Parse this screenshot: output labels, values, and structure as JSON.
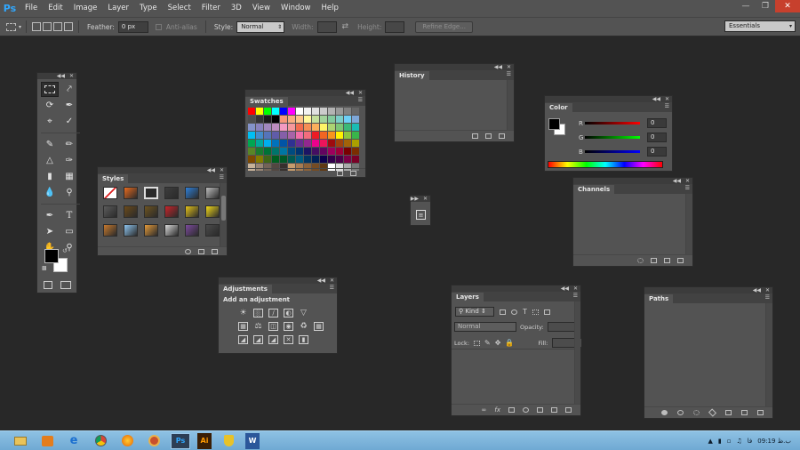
{
  "menubar": {
    "app_logo": "Ps",
    "items": [
      "File",
      "Edit",
      "Image",
      "Layer",
      "Type",
      "Select",
      "Filter",
      "3D",
      "View",
      "Window",
      "Help"
    ]
  },
  "options": {
    "feather_label": "Feather:",
    "feather_value": "0 px",
    "antialias_label": "Anti-alias",
    "style_label": "Style:",
    "style_value": "Normal",
    "width_label": "Width:",
    "height_label": "Height:",
    "refine_edge_label": "Refine Edge...",
    "workspace": "Essentials"
  },
  "panels": {
    "swatches": "Swatches",
    "styles": "Styles",
    "history": "History",
    "color": "Color",
    "channels": "Channels",
    "adjustments": "Adjustments",
    "adjustments_heading": "Add an adjustment",
    "layers": "Layers",
    "paths": "Paths"
  },
  "color_panel": {
    "r_label": "R",
    "r_value": "0",
    "g_label": "G",
    "g_value": "0",
    "b_label": "B",
    "b_value": "0"
  },
  "layers_panel": {
    "kind_label": "Kind",
    "blend_mode": "Normal",
    "opacity_label": "Opacity:",
    "lock_label": "Lock:",
    "fill_label": "Fill:"
  },
  "swatch_colors": [
    "#ff0000",
    "#ffff00",
    "#00ff00",
    "#00ffff",
    "#0000ff",
    "#ff00ff",
    "#ffffff",
    "#f2f2f2",
    "#e0e0e0",
    "#cccccc",
    "#b3b3b3",
    "#999999",
    "#808080",
    "#666666",
    "#4d4d4d",
    "#333333",
    "#1a1a1a",
    "#000000",
    "#f7977a",
    "#f9ad81",
    "#fdc68a",
    "#fff79a",
    "#c4df9b",
    "#a2d39c",
    "#82ca9d",
    "#7bcdc8",
    "#6ecff6",
    "#7ea7d8",
    "#8493ca",
    "#8882be",
    "#a187be",
    "#bc8dbf",
    "#f49ac2",
    "#f6989d",
    "#f26c4f",
    "#f68e55",
    "#fbaf5c",
    "#fff467",
    "#acd372",
    "#7cc576",
    "#3bb878",
    "#1abbb4",
    "#00bff3",
    "#438ccb",
    "#5574b9",
    "#605ca8",
    "#855fa8",
    "#a763a8",
    "#f06ea9",
    "#f26d7d",
    "#ed1c24",
    "#f26522",
    "#f7941d",
    "#fff200",
    "#8dc63f",
    "#39b54a",
    "#00a651",
    "#00a99d",
    "#00aeef",
    "#0072bc",
    "#0054a6",
    "#2e3192",
    "#662d91",
    "#92278f",
    "#ec008c",
    "#ed145b",
    "#9e0b0f",
    "#a0410d",
    "#a36209",
    "#aba000",
    "#598527",
    "#1a7b30",
    "#007236",
    "#00746b",
    "#0076a3",
    "#004b80",
    "#003471",
    "#1b1464",
    "#440e62",
    "#630460",
    "#9e005d",
    "#9e0039",
    "#790000",
    "#7b2e00",
    "#7d4900",
    "#827b00",
    "#406618",
    "#005e20",
    "#005826",
    "#005952",
    "#005b7f",
    "#003663",
    "#002157",
    "#0d004c",
    "#32004b",
    "#4b0049",
    "#7b0046",
    "#7a0026",
    "#c7b299",
    "#998675",
    "#736357",
    "#534741",
    "#37302d",
    "#c69c6d",
    "#a67c52",
    "#8c6239",
    "#754c24",
    "#603913",
    "#ffffff",
    "#dddddd",
    "#aaaaaa",
    "#777777"
  ],
  "style_colors": [
    "#f4f4f4",
    "#e86a1e",
    "#2a2a2a",
    "#3d3d3d",
    "#2f7fd8",
    "#bdbdbd",
    "#5c5c5c",
    "#6b4a1a",
    "#6e5420",
    "#c8242a",
    "#e3c21a",
    "#f2d91a",
    "#c7792e",
    "#8ec5ef",
    "#e39a3a",
    "#d9d9d9",
    "#7b4a9c",
    "#4a4a4a"
  ],
  "taskbar": {
    "apps": [
      "Ps",
      "Ai",
      "W"
    ],
    "clock": "09:19",
    "period": "ب.ظ"
  }
}
